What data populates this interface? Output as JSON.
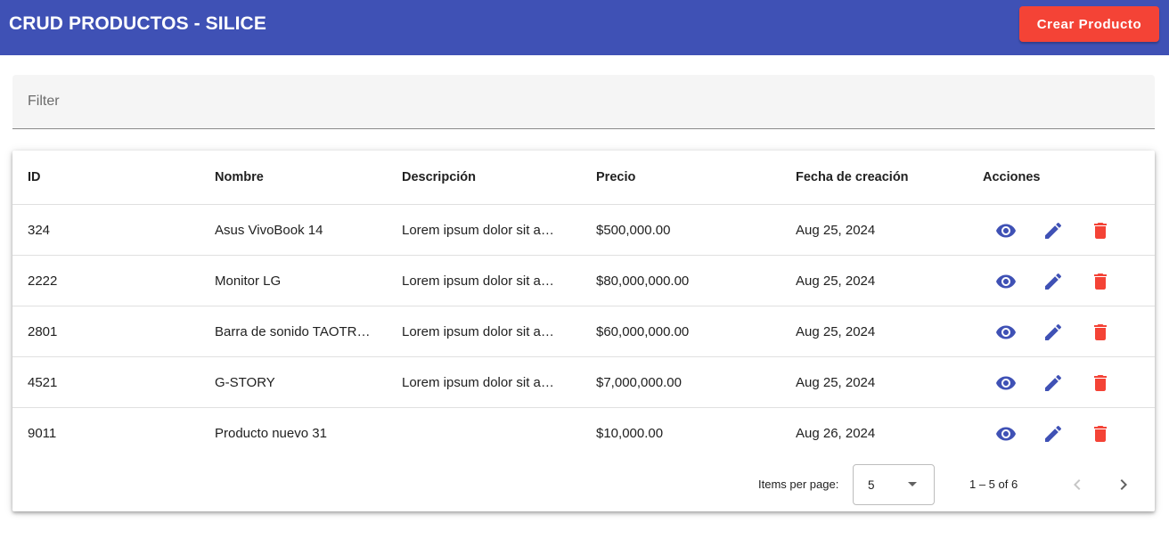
{
  "header": {
    "title": "CRUD PRODUCTOS - SILICE",
    "create_button_label": "Crear Producto"
  },
  "filter": {
    "placeholder": "Filter",
    "value": ""
  },
  "table": {
    "columns": [
      "ID",
      "Nombre",
      "Descripción",
      "Precio",
      "Fecha de creación",
      "Acciones"
    ],
    "rows": [
      {
        "id": "324",
        "nombre": "Asus VivoBook 14",
        "descripcion": "Lorem ipsum dolor sit a…",
        "precio": "$500,000.00",
        "fecha": "Aug 25, 2024"
      },
      {
        "id": "2222",
        "nombre": "Monitor LG",
        "descripcion": "Lorem ipsum dolor sit a…",
        "precio": "$80,000,000.00",
        "fecha": "Aug 25, 2024"
      },
      {
        "id": "2801",
        "nombre": "Barra de sonido TAOTR…",
        "descripcion": "Lorem ipsum dolor sit a…",
        "precio": "$60,000,000.00",
        "fecha": "Aug 25, 2024"
      },
      {
        "id": "4521",
        "nombre": "G-STORY",
        "descripcion": "Lorem ipsum dolor sit a…",
        "precio": "$7,000,000.00",
        "fecha": "Aug 25, 2024"
      },
      {
        "id": "9011",
        "nombre": "Producto nuevo 31",
        "descripcion": "",
        "precio": "$10,000.00",
        "fecha": "Aug 26, 2024"
      }
    ],
    "row_actions": [
      "eye-icon",
      "pencil-icon",
      "trash-icon"
    ]
  },
  "paginator": {
    "items_per_page_label": "Items per page:",
    "items_per_page_value": "5",
    "range_label": "1 – 5 of 6",
    "prev_icon": "chevron-left-icon",
    "next_icon": "chevron-right-icon"
  },
  "colors": {
    "primary": "#3f51b5",
    "accent_warn": "#f44336",
    "header_text": "#ffffff"
  }
}
